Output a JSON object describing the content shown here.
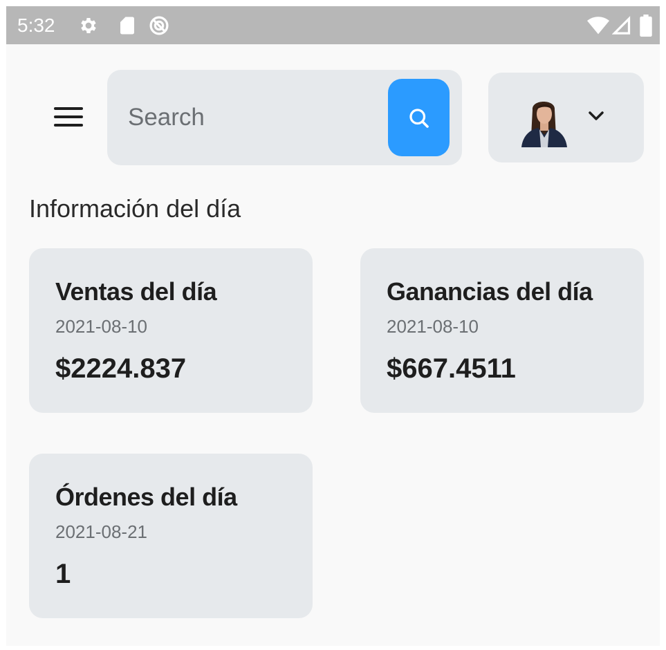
{
  "status_bar": {
    "time": "5:32",
    "left_icons": [
      "gear-icon",
      "sd-card-icon",
      "do-not-disturb-icon"
    ],
    "right_icons": [
      "wifi-icon",
      "cellular-signal-icon",
      "battery-icon"
    ]
  },
  "header": {
    "menu_icon": "hamburger-menu-icon",
    "search": {
      "placeholder": "Search",
      "value": "",
      "button_icon": "search-icon",
      "button_color": "#2b9bff"
    },
    "profile": {
      "avatar": "avatar",
      "dropdown_icon": "chevron-down-icon"
    }
  },
  "section_title": "Información del día",
  "cards": [
    {
      "title": "Ventas del día",
      "date": "2021-08-10",
      "value": "$2224.837"
    },
    {
      "title": "Ganancias del día",
      "date": "2021-08-10",
      "value": "$667.4511"
    },
    {
      "title": "Órdenes del día",
      "date": "2021-08-21",
      "value": "1"
    }
  ],
  "colors": {
    "status_bar": "#b7b7b7",
    "background": "#f9f9f9",
    "card": "#e6e9ec",
    "accent": "#2b9bff"
  }
}
